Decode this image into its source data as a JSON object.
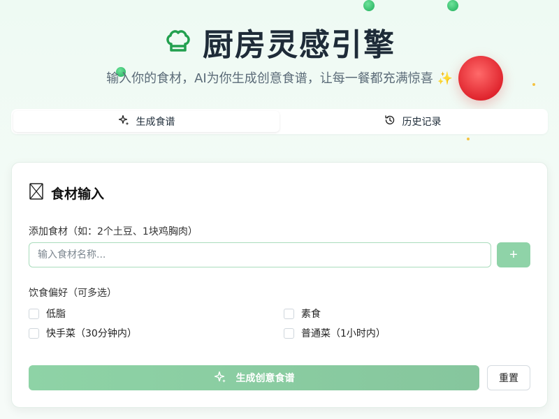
{
  "header": {
    "title": "厨房灵感引擎",
    "subtitle": "输入你的食材，AI为你生成创意食谱，让每一餐都充满惊喜 ✨"
  },
  "tabs": [
    {
      "label": "生成食谱",
      "icon": "sparkles-icon",
      "active": true
    },
    {
      "label": "历史记录",
      "icon": "history-icon",
      "active": false
    }
  ],
  "card": {
    "title": "食材输入",
    "title_icon": "ingredient-icon",
    "add_label": "添加食材（如：2个土豆、1块鸡胸肉）",
    "input_placeholder": "输入食材名称...",
    "input_value": "",
    "add_button": "+",
    "pref_label": "饮食偏好（可多选）",
    "preferences": [
      {
        "label": "低脂",
        "checked": false
      },
      {
        "label": "素食",
        "checked": false
      },
      {
        "label": "快手菜（30分钟内）",
        "checked": false
      },
      {
        "label": "普通菜（1小时内）",
        "checked": false
      }
    ],
    "generate_button": "生成创意食谱",
    "reset_button": "重置"
  },
  "colors": {
    "accent": "#8fd3a8",
    "brand_green": "#22a04f",
    "decor_red": "#e0252e"
  }
}
